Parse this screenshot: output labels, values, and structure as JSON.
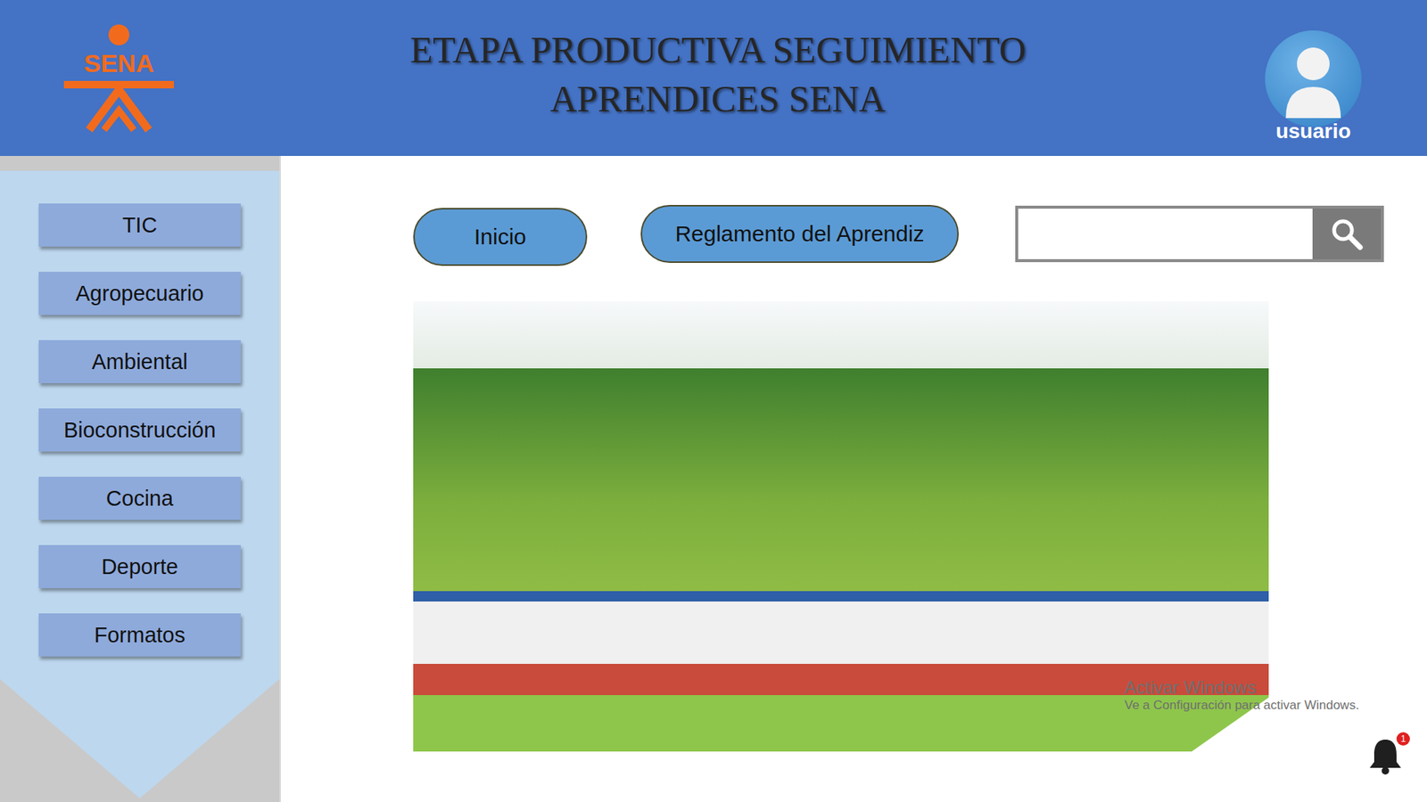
{
  "header": {
    "logo": "SENA",
    "title_lines": [
      "ETAPA PRODUCTIVA SEGUIMIENTO",
      "APRENDICES SENA"
    ],
    "user": "usuario"
  },
  "sidebar": {
    "items": [
      {
        "label": "TIC"
      },
      {
        "label": "Agropecuario"
      },
      {
        "label": "Ambiental"
      },
      {
        "label": "Bioconstrucción"
      },
      {
        "label": "Cocina"
      },
      {
        "label": "Deporte"
      },
      {
        "label": "Formatos"
      }
    ]
  },
  "nav": {
    "buttons": [
      {
        "label": "Inicio"
      },
      {
        "label": "Reglamento del Aprendiz"
      }
    ]
  },
  "notifications": {
    "count": "1"
  },
  "watermark": {
    "title": "Activar Windows",
    "subtitle": "Ve a Configuración para activar Windows."
  }
}
